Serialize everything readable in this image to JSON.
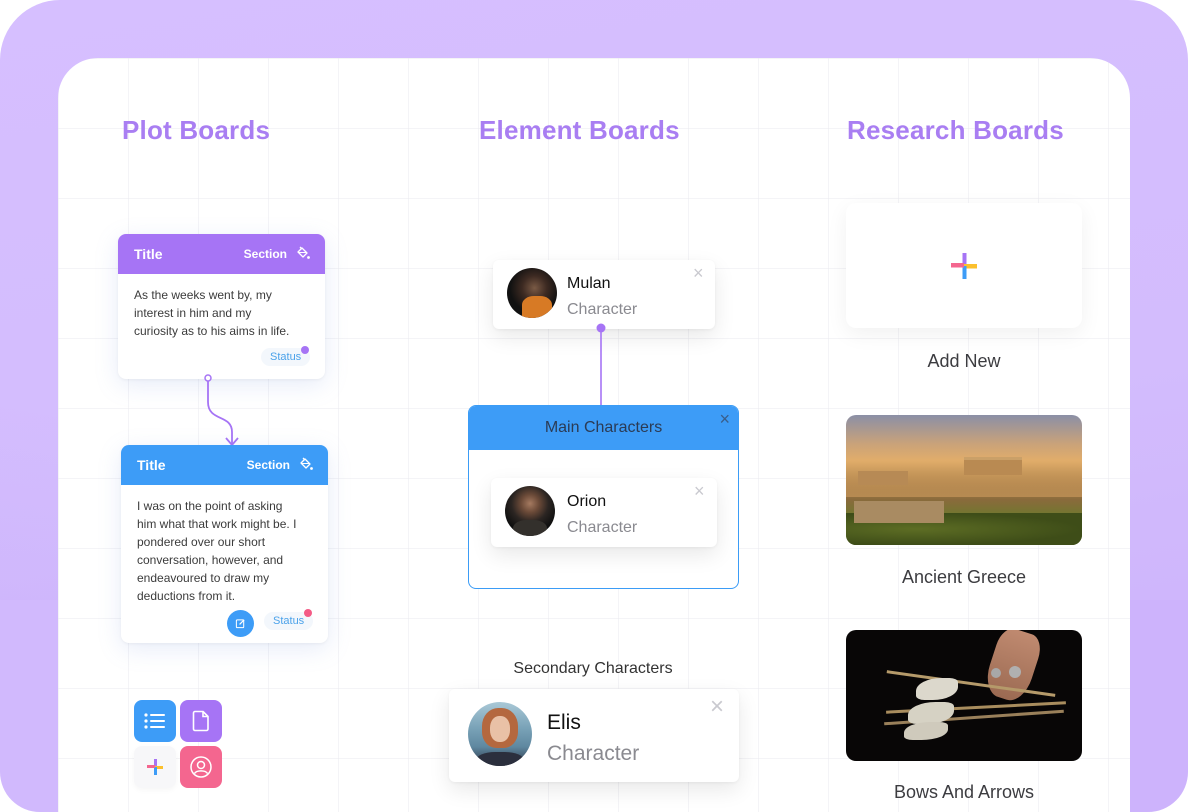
{
  "columns": {
    "plot": "Plot Boards",
    "element": "Element Boards",
    "research": "Research Boards"
  },
  "plot_cards": [
    {
      "title": "Title",
      "section": "Section",
      "text_lines": [
        "As the weeks went by, my",
        "interest in him and my",
        "curiosity as to his aims in life."
      ],
      "status": "Status",
      "header_color": "#a674f5",
      "status_dot_color": "#a674f5"
    },
    {
      "title": "Title",
      "section": "Section",
      "text_lines": [
        "I was on the point of asking",
        "him what that work might be. I",
        "pondered over our short",
        "conversation, however, and",
        "endeavoured to draw my",
        "deductions from it."
      ],
      "status": "Status",
      "header_color": "#3d9cf7",
      "status_dot_color": "#f45b86",
      "edit_icon": "edit-icon"
    }
  ],
  "quick_icons": [
    {
      "name": "list-icon",
      "color": "#3d9cf7"
    },
    {
      "name": "document-icon",
      "color": "#a674f5"
    },
    {
      "name": "plus-icon",
      "color": "#f7f7f9"
    },
    {
      "name": "user-circle-icon",
      "color": "#f4668f"
    }
  ],
  "characters": {
    "mulan": {
      "name": "Mulan",
      "role": "Character"
    },
    "orion": {
      "name": "Orion",
      "role": "Character"
    },
    "elis": {
      "name": "Elis",
      "role": "Character"
    }
  },
  "groups": {
    "main": "Main Characters",
    "secondary": "Secondary Characters"
  },
  "research": [
    {
      "label": "Add New",
      "icon": "plus-icon"
    },
    {
      "label": "Ancient Greece"
    },
    {
      "label": "Bows And Arrows"
    }
  ],
  "colors": {
    "purple": "#a674f5",
    "blue": "#3d9cf7",
    "pink": "#f4668f",
    "yellow": "#fbc02d",
    "title_purple": "#a97ef2"
  }
}
